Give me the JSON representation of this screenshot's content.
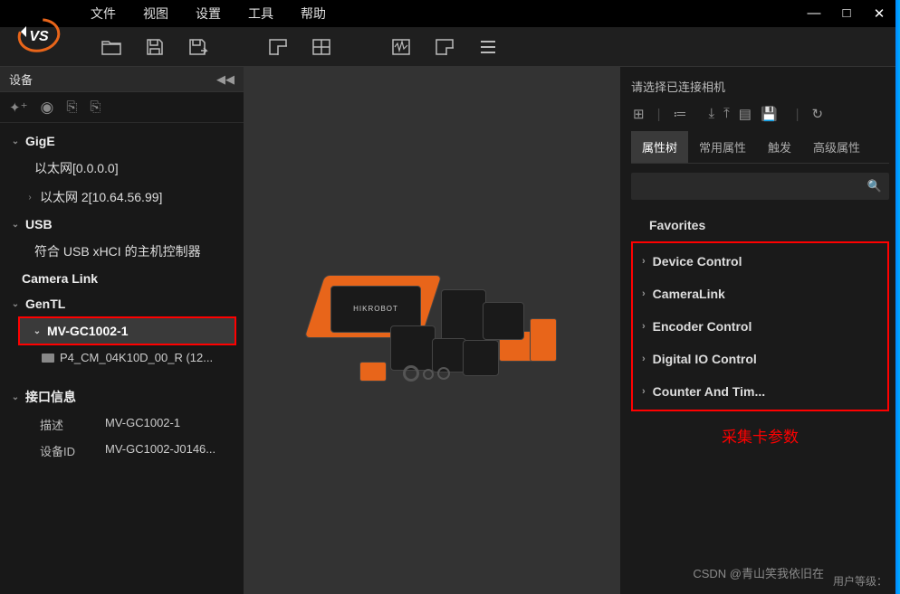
{
  "app": {
    "name": "MVS"
  },
  "menu": {
    "file": "文件",
    "view": "视图",
    "settings": "设置",
    "tools": "工具",
    "help": "帮助"
  },
  "sidebar": {
    "title": "设备",
    "groups": {
      "gige": {
        "label": "GigE",
        "items": [
          "以太网[0.0.0.0]",
          "以太网 2[10.64.56.99]"
        ]
      },
      "usb": {
        "label": "USB",
        "items": [
          "符合 USB xHCI 的主机控制器"
        ]
      },
      "camlink": {
        "label": "Camera Link"
      },
      "gentl": {
        "label": "GenTL",
        "selected": "MV-GC1002-1",
        "child": "P4_CM_04K10D_00_R (12..."
      }
    },
    "info": {
      "title": "接口信息",
      "desc_k": "描述",
      "desc_v": "MV-GC1002-1",
      "id_k": "设备ID",
      "id_v": "MV-GC1002-J0146..."
    }
  },
  "center": {
    "brand": "HIKROBOT"
  },
  "right": {
    "prompt": "请选择已连接相机",
    "tabs": {
      "t1": "属性树",
      "t2": "常用属性",
      "t3": "触发",
      "t4": "高级属性"
    },
    "props": {
      "fav": "Favorites",
      "p1": "Device Control",
      "p2": "CameraLink",
      "p3": "Encoder Control",
      "p4": "Digital IO Control",
      "p5": "Counter And Tim..."
    },
    "annotation": "采集卡参数",
    "userlevel": "用户等级："
  },
  "watermark": "CSDN @青山笑我依旧在"
}
